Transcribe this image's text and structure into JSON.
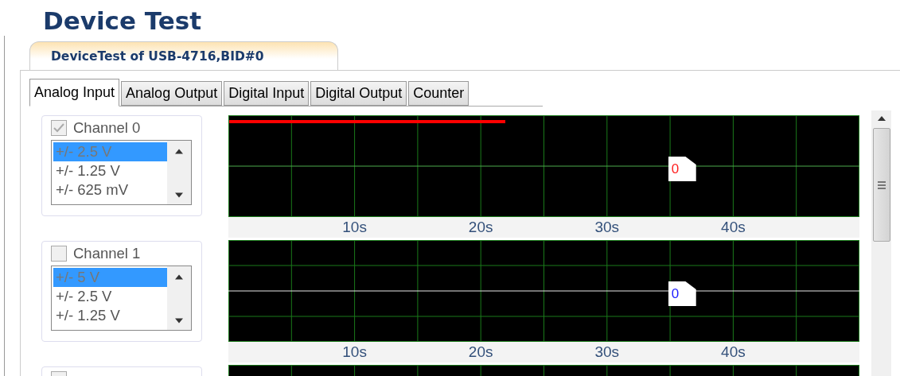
{
  "title": "Device Test",
  "device_tab": {
    "label": "DeviceTest of USB-4716,BID#0"
  },
  "tabs": [
    {
      "label": "Analog Input",
      "selected": true
    },
    {
      "label": "Analog Output",
      "selected": false
    },
    {
      "label": "Digital Input",
      "selected": false
    },
    {
      "label": "Digital Output",
      "selected": false
    },
    {
      "label": "Counter",
      "selected": false
    }
  ],
  "channels": [
    {
      "label": "Channel 0",
      "checked": true,
      "ranges": [
        {
          "label": "+/- 2.5 V",
          "selected": true
        },
        {
          "label": "+/- 1.25 V",
          "selected": false
        },
        {
          "label": "+/- 625 mV",
          "selected": false
        }
      ],
      "marker": {
        "text": "0",
        "color": "#ff2020"
      },
      "axis_labels": [
        "10s",
        "20s",
        "30s",
        "40s"
      ]
    },
    {
      "label": "Channel 1",
      "checked": false,
      "ranges": [
        {
          "label": "+/- 5 V",
          "selected": true
        },
        {
          "label": "+/- 2.5 V",
          "selected": false
        },
        {
          "label": "+/- 1.25 V",
          "selected": false
        }
      ],
      "marker": {
        "text": "0",
        "color": "#2020ff"
      },
      "axis_labels": [
        "10s",
        "20s",
        "30s",
        "40s"
      ]
    },
    {
      "checked": false
    }
  ]
}
